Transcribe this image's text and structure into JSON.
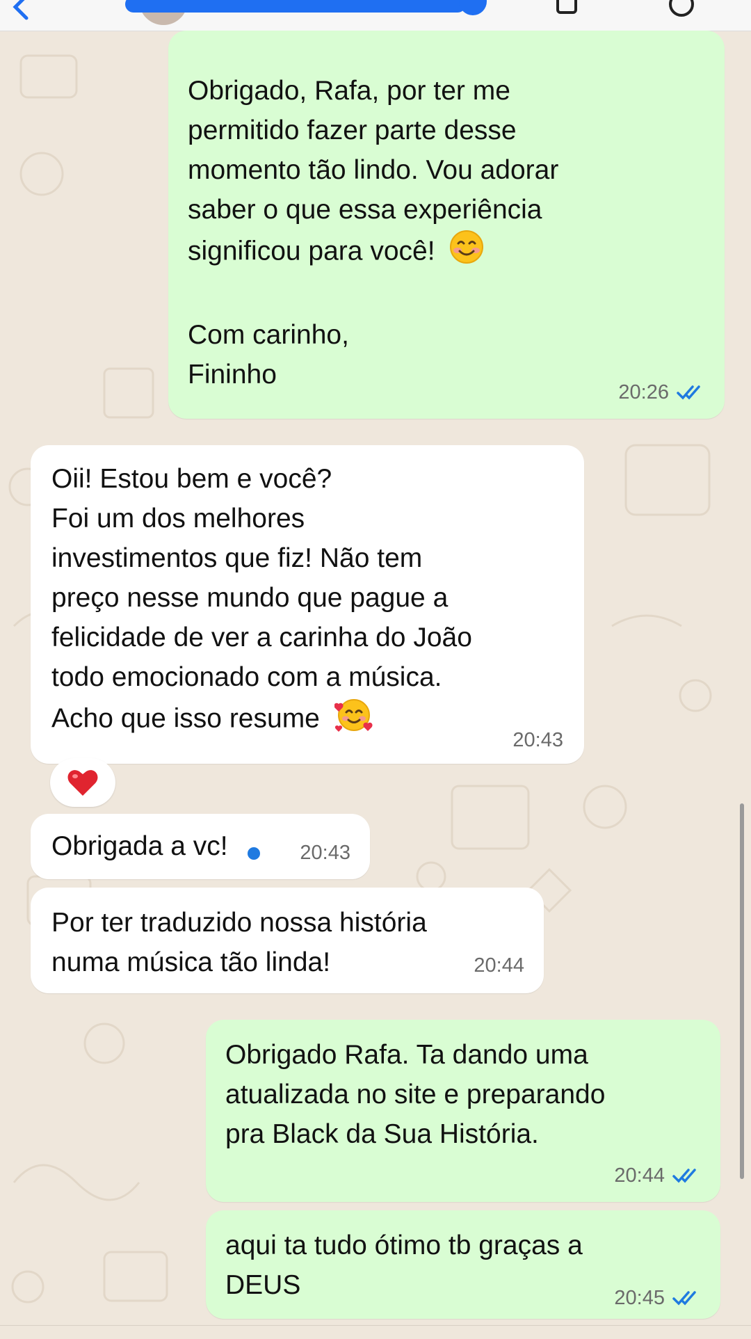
{
  "messages": [
    {
      "direction": "outgoing",
      "text": "Obrigado, Rafa, por ter me\npermitido fazer parte desse\nmomento tão lindo. Vou adorar\nsaber o que essa experiência\nsignificou para você!",
      "emoji": "smiling-face-emoji",
      "text2": "Com carinho,\nFininho",
      "time": "20:26",
      "status": "read"
    },
    {
      "direction": "incoming",
      "text": "Oii! Estou bem e você?\nFoi um dos melhores\ninvestimentos que fiz! Não tem\npreço nesse mundo que pague a\nfelicidade de ver a carinha do João\ntodo emocionado com a música.\nAcho que isso resume",
      "emoji": "smiling-face-with-hearts-emoji",
      "time": "20:43",
      "reaction": "❤️"
    },
    {
      "direction": "incoming",
      "text": "Obrigada a vc!",
      "time": "20:43"
    },
    {
      "direction": "incoming",
      "text": "Por ter traduzido nossa história\nnuma música tão linda!",
      "time": "20:44"
    },
    {
      "direction": "outgoing",
      "text": "Obrigado Rafa. Ta dando uma\natualizada no site e preparando\npra Black da Sua História.",
      "time": "20:44",
      "status": "read"
    },
    {
      "direction": "outgoing",
      "text": "aqui ta tudo ótimo tb graças a\nDEUS",
      "time": "20:45",
      "status": "read"
    }
  ],
  "colors": {
    "outgoing_bubble": "#d9fdd3",
    "incoming_bubble": "#ffffff",
    "chat_background": "#efe7dc",
    "read_ticks": "#1f7ae0"
  }
}
